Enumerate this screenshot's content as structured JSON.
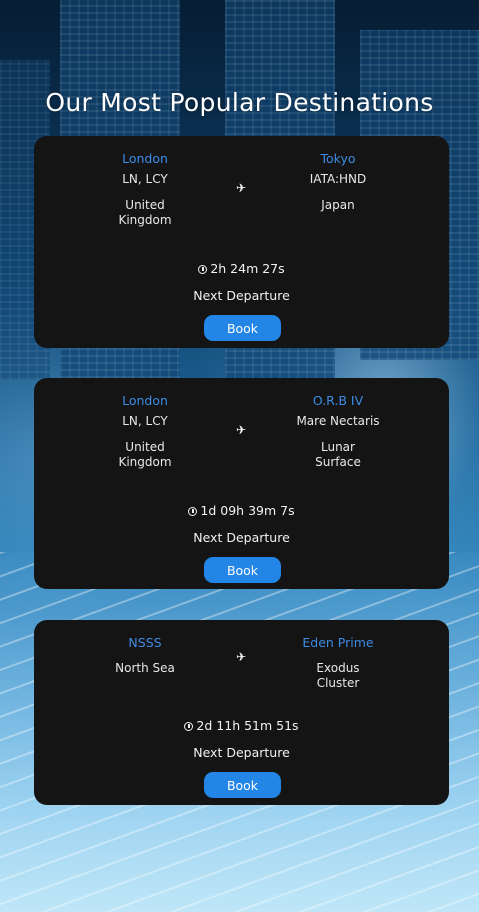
{
  "page": {
    "title": "Our Most Popular Destinations"
  },
  "colors": {
    "card_bg": "#141414",
    "accent_blue": "#3d8be3",
    "button_blue": "#2385e6",
    "text": "#f2f2f2"
  },
  "destinations": [
    {
      "origin": {
        "name": "London",
        "code": "LN, LCY",
        "region": "United Kingdom"
      },
      "destination": {
        "name": "Tokyo",
        "code": "IATA:HND",
        "region": "Japan"
      },
      "plane_icon": "airplane-icon",
      "countdown": "2h 24m 27s",
      "next_label": "Next Departure",
      "book_label": "Book"
    },
    {
      "origin": {
        "name": "London",
        "code": "LN, LCY",
        "region": "United Kingdom"
      },
      "destination": {
        "name": "O.R.B IV",
        "code": "Mare Nectaris",
        "region": "Lunar Surface"
      },
      "plane_icon": "airplane-icon",
      "countdown": "1d 09h 39m 7s",
      "next_label": "Next Departure",
      "book_label": "Book"
    },
    {
      "origin": {
        "name": "NSSS",
        "region": "North Sea"
      },
      "destination": {
        "name": "Eden Prime",
        "region": "Exodus Cluster"
      },
      "plane_icon": "airplane-icon",
      "countdown": "2d 11h 51m 51s",
      "next_label": "Next Departure",
      "book_label": "Book"
    }
  ]
}
